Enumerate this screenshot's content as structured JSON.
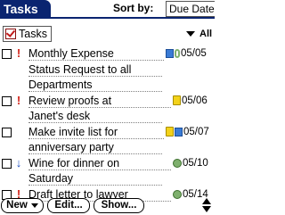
{
  "app": {
    "title": "Tasks"
  },
  "sort": {
    "label": "Sort by:",
    "value": "Due Date"
  },
  "category": {
    "label": "Tasks",
    "filter": "All"
  },
  "tasks": [
    {
      "priority": "!",
      "lines": [
        "Monthly Expense",
        "Status Request to all",
        "Departments"
      ],
      "icons": [
        "calendar-icon",
        "link-icon"
      ],
      "due": "05/05",
      "checked": false
    },
    {
      "priority": "!",
      "lines": [
        "Review proofs at",
        "Janet's desk"
      ],
      "icons": [
        "note-icon"
      ],
      "due": "05/06",
      "checked": false
    },
    {
      "priority": "",
      "lines": [
        "Make invite list for",
        "anniversary party"
      ],
      "icons": [
        "note-icon",
        "calendar-icon"
      ],
      "due": "05/07",
      "checked": false
    },
    {
      "priority": "↓",
      "lines": [
        "Wine for dinner on",
        "Saturday"
      ],
      "icons": [
        "alarm-icon"
      ],
      "due": "05/10",
      "checked": false
    },
    {
      "priority": "!",
      "lines": [
        "Draft letter to lawyer"
      ],
      "icons": [
        "alarm-icon"
      ],
      "due": "05/14",
      "checked": false
    }
  ],
  "buttons": {
    "new": "New",
    "edit": "Edit...",
    "show": "Show..."
  },
  "colors": {
    "title_bar": "#0a2470",
    "high_priority": "#d2231a",
    "low_priority": "#1f4fc4"
  }
}
